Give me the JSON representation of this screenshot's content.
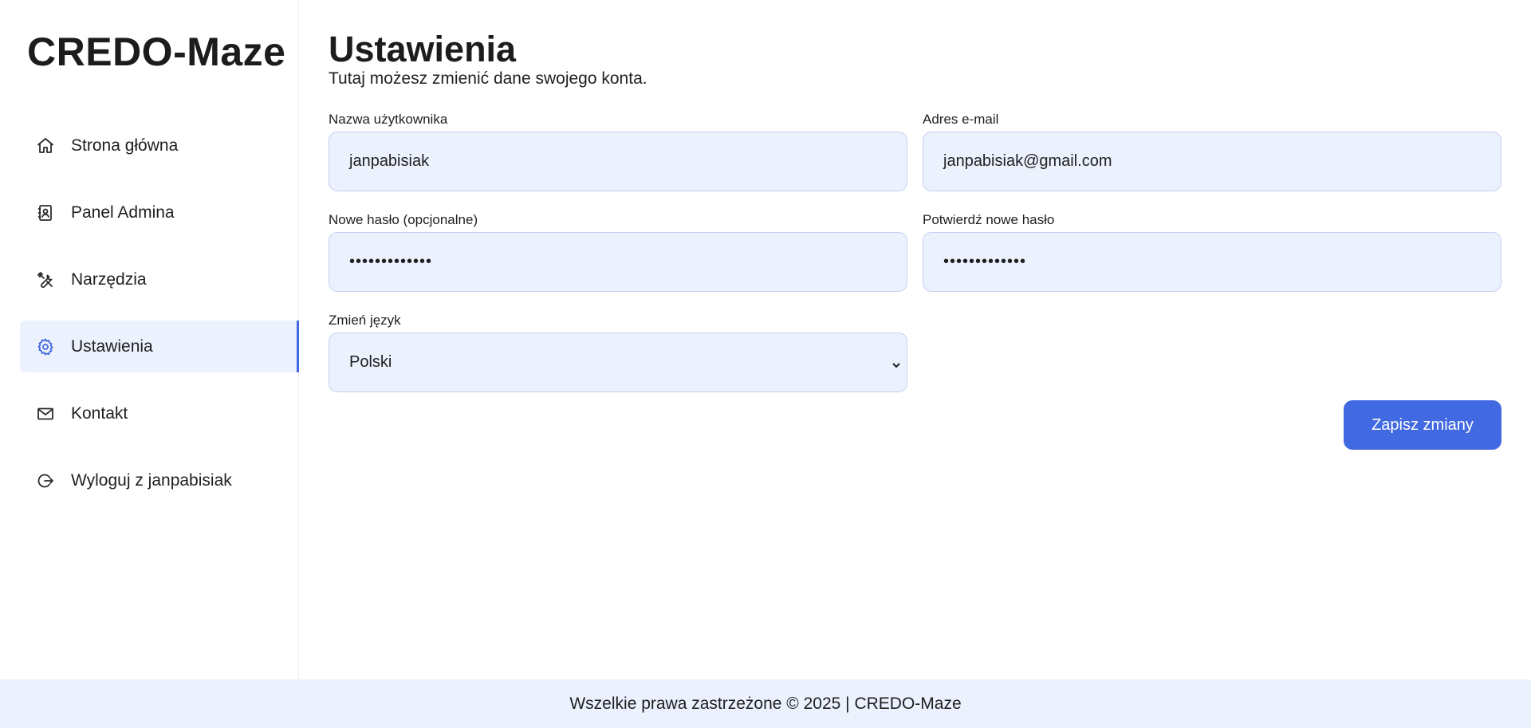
{
  "brand": "CREDO-Maze",
  "sidebar": {
    "items": [
      {
        "label": "Strona główna",
        "icon": "home-icon"
      },
      {
        "label": "Panel Admina",
        "icon": "contact-book-icon"
      },
      {
        "label": "Narzędzia",
        "icon": "tools-icon"
      },
      {
        "label": "Ustawienia",
        "icon": "gear-icon",
        "active": true
      },
      {
        "label": "Kontakt",
        "icon": "mail-icon"
      },
      {
        "label": "Wyloguj z janpabisiak",
        "icon": "logout-icon"
      }
    ]
  },
  "main": {
    "title": "Ustawienia",
    "subtitle": "Tutaj możesz zmienić dane swojego konta.",
    "fields": {
      "username": {
        "label": "Nazwa użytkownika",
        "value": "janpabisiak"
      },
      "email": {
        "label": "Adres e-mail",
        "value": "janpabisiak@gmail.com"
      },
      "new_password": {
        "label": "Nowe hasło (opcjonalne)",
        "value": "•••••••••••••"
      },
      "confirm_password": {
        "label": "Potwierdź nowe hasło",
        "value": "•••••••••••••"
      },
      "language": {
        "label": "Zmień język",
        "value": "Polski"
      }
    },
    "save_label": "Zapisz zmiany"
  },
  "footer": {
    "text": "Wszelkie prawa zastrzeżone © 2025 | CREDO-Maze"
  },
  "colors": {
    "accent": "#4169e1",
    "input_bg": "#ecf1fe",
    "input_border": "#c5d1f1"
  }
}
